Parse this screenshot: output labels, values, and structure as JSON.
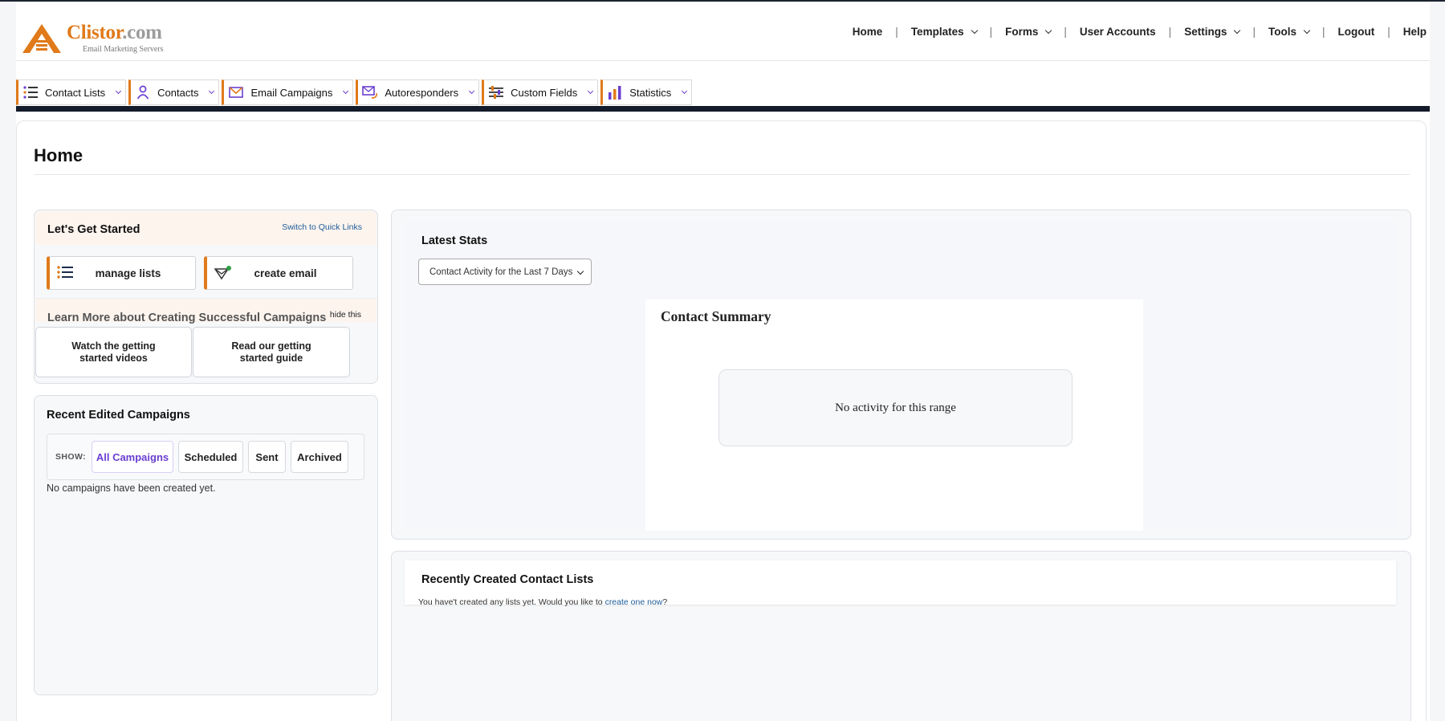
{
  "brand": {
    "name": "Clistor",
    "domain_suffix": ".com",
    "tagline": "Email Marketing Servers",
    "accent_color": "#e07a1a",
    "purple_color": "#6a3fd0"
  },
  "top_nav": [
    {
      "label": "Home",
      "dropdown": false
    },
    {
      "label": "Templates",
      "dropdown": true
    },
    {
      "label": "Forms",
      "dropdown": true
    },
    {
      "label": "User Accounts",
      "dropdown": false
    },
    {
      "label": "Settings",
      "dropdown": true
    },
    {
      "label": "Tools",
      "dropdown": true
    },
    {
      "label": "Logout",
      "dropdown": false
    },
    {
      "label": "Help",
      "dropdown": false
    }
  ],
  "tabs": [
    {
      "label": "Contact Lists",
      "icon": "list-icon"
    },
    {
      "label": "Contacts",
      "icon": "person-icon"
    },
    {
      "label": "Email Campaigns",
      "icon": "envelope-icon"
    },
    {
      "label": "Autoresponders",
      "icon": "autoresponder-icon"
    },
    {
      "label": "Custom Fields",
      "icon": "sliders-icon"
    },
    {
      "label": "Statistics",
      "icon": "bar-chart-icon"
    }
  ],
  "page_title": "Home",
  "get_started": {
    "title": "Let's Get Started",
    "switch_link": "Switch to Quick Links",
    "manage_lists": "manage lists",
    "create_email": "create email",
    "learn_title": "Learn More about Creating Successful Campaigns",
    "hide_link": "hide this",
    "videos_line1": "Watch the getting",
    "videos_line2": "started videos",
    "guide_line1": "Read our getting",
    "guide_line2": "started guide"
  },
  "recent_campaigns": {
    "title": "Recent Edited Campaigns",
    "show_label": "SHOW:",
    "filters": [
      "All Campaigns",
      "Scheduled",
      "Sent",
      "Archived"
    ],
    "active_filter": "All Campaigns",
    "empty_text": "No campaigns have been created yet."
  },
  "latest_stats": {
    "title": "Latest Stats",
    "range_selected": "Contact Activity for the Last 7 Days",
    "summary_title": "Contact Summary",
    "no_activity": "No activity for this range"
  },
  "recent_lists": {
    "title": "Recently Created Contact Lists",
    "message": "You have't created any lists yet. Would you like to ",
    "link": "create one now",
    "message_end": "?"
  }
}
